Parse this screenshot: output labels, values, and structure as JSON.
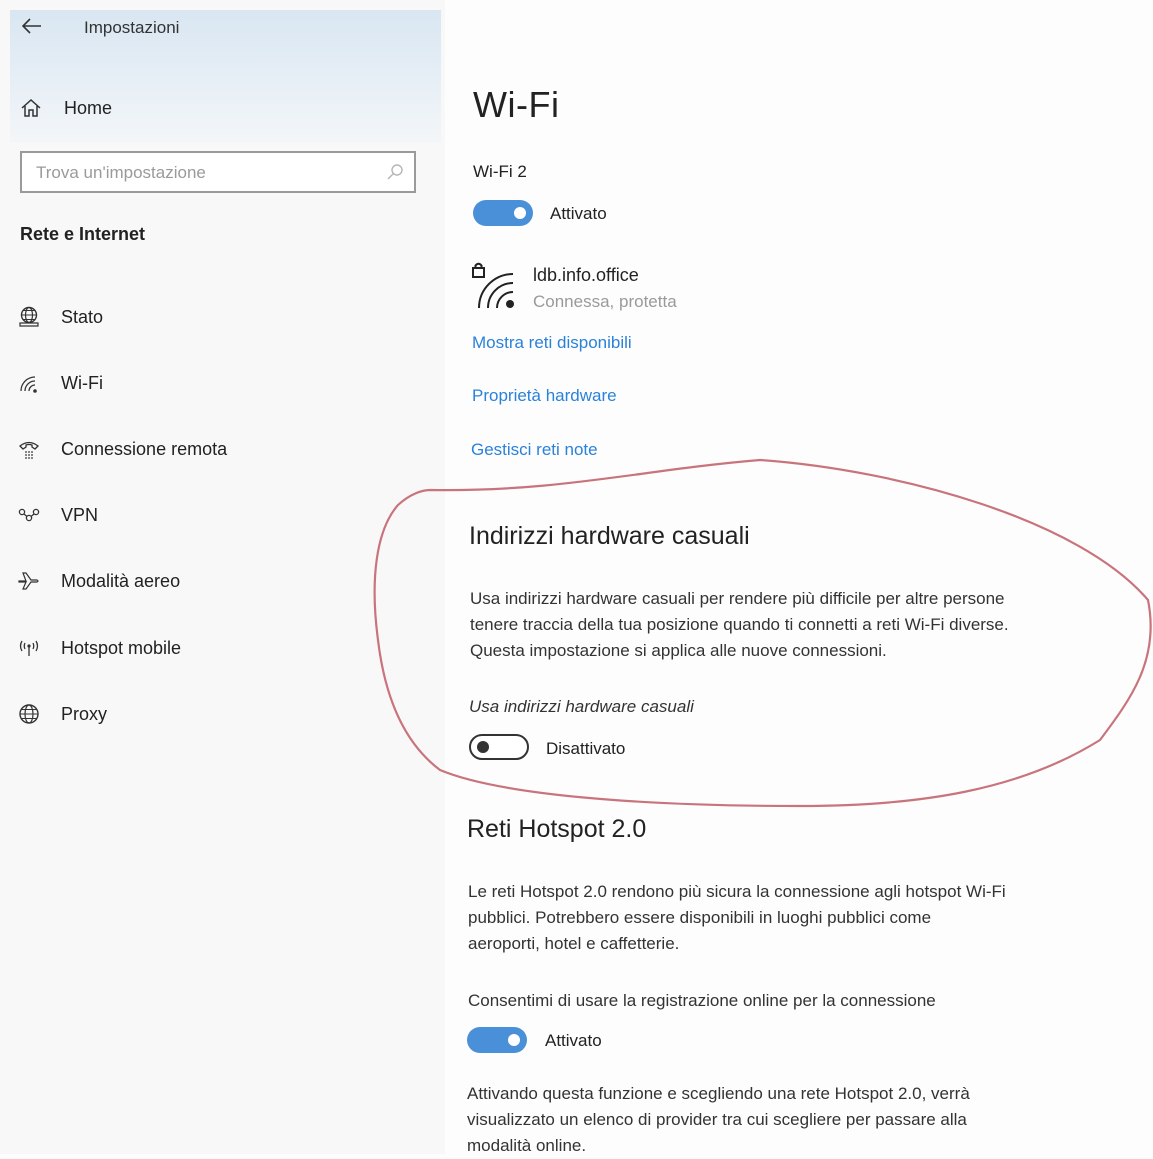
{
  "sidebar": {
    "title": "Impostazioni",
    "home_label": "Home",
    "search": {
      "placeholder": "Trova un'impostazione",
      "value": ""
    },
    "section_title": "Rete e Internet",
    "items": [
      {
        "label": "Stato",
        "icon": "globe-monitor-icon"
      },
      {
        "label": "Wi-Fi",
        "icon": "wifi-icon"
      },
      {
        "label": "Connessione remota",
        "icon": "phone-icon"
      },
      {
        "label": "VPN",
        "icon": "vpn-icon"
      },
      {
        "label": "Modalità aereo",
        "icon": "airplane-icon"
      },
      {
        "label": "Hotspot mobile",
        "icon": "hotspot-icon"
      },
      {
        "label": "Proxy",
        "icon": "globe-icon"
      }
    ]
  },
  "main": {
    "title": "Wi-Fi",
    "adapter": "Wi-Fi 2",
    "wifi_toggle": {
      "state": "on",
      "label": "Attivato"
    },
    "network": {
      "name": "ldb.info.office",
      "status": "Connessa, protetta",
      "icon": "wifi-secured-icon"
    },
    "links": {
      "show_networks": "Mostra reti disponibili",
      "hardware_properties": "Proprietà hardware",
      "manage_known": "Gestisci reti note"
    },
    "random_hw": {
      "heading": "Indirizzi hardware casuali",
      "description_lines": [
        "Usa indirizzi hardware casuali per rendere più difficile per altre persone",
        "tenere traccia della tua posizione quando ti connetti a reti Wi-Fi diverse.",
        "Questa impostazione si applica alle nuove connessioni."
      ],
      "setting_label": "Usa indirizzi hardware casuali",
      "toggle": {
        "state": "off",
        "label": "Disattivato"
      }
    },
    "hotspot20": {
      "heading": "Reti Hotspot 2.0",
      "description_lines": [
        "Le reti Hotspot 2.0 rendono più sicura la connessione agli hotspot Wi-Fi",
        "pubblici. Potrebbero essere disponibili in luoghi pubblici come",
        "aeroporti, hotel e caffetterie."
      ],
      "setting_label": "Consentimi di usare la registrazione online per la connessione",
      "toggle": {
        "state": "on",
        "label": "Attivato"
      },
      "footer_lines": [
        "Attivando questa funzione e scegliendo una rete Hotspot 2.0, verrà",
        "visualizzato un elenco di provider tra cui scegliere per passare alla",
        "modalità online."
      ]
    }
  },
  "colors": {
    "accent": "#2b82d9",
    "toggle_on": "#4a90d9",
    "annotation": "#c9747c"
  }
}
